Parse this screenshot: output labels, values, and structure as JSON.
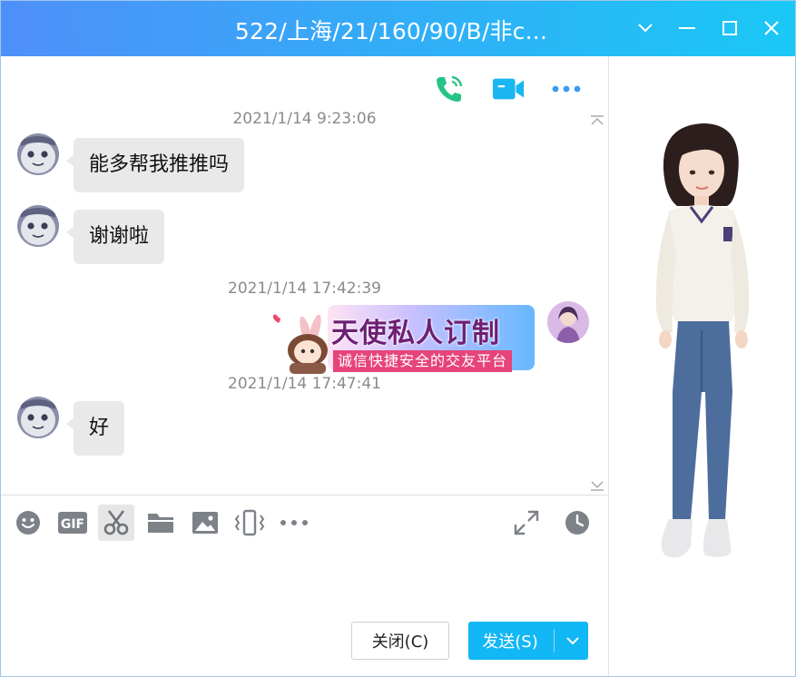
{
  "window": {
    "title": "522/上海/21/160/90/B/非c..."
  },
  "colors": {
    "titlebar_start": "#4f8ff9",
    "titlebar_end": "#1ac8f5",
    "accent": "#12b7f5",
    "bubble": "#e9e9e9",
    "call_icon": "#25c486"
  },
  "top_icons": [
    "phone-call-icon",
    "video-call-icon",
    "more-icon"
  ],
  "messages": [
    {
      "type": "timestamp",
      "text": "2021/1/14 9:23:06"
    },
    {
      "type": "incoming",
      "text": "能多帮我推推吗"
    },
    {
      "type": "incoming",
      "text": "谢谢啦"
    },
    {
      "type": "timestamp",
      "text": "2021/1/14 17:42:39"
    },
    {
      "type": "outgoing-sticker",
      "title": "天使私人订制",
      "subtitle": "诚信快捷安全的交友平台"
    },
    {
      "type": "timestamp",
      "text": "2021/1/14 17:47:41"
    },
    {
      "type": "incoming",
      "text": "好"
    }
  ],
  "toolbar_icons": [
    "emoji-icon",
    "gif-icon",
    "scissors-icon",
    "folder-icon",
    "image-icon",
    "shake-icon",
    "more-tools-icon",
    "expand-icon",
    "history-clock-icon"
  ],
  "buttons": {
    "close": "关闭(C)",
    "send": "发送(S)"
  }
}
